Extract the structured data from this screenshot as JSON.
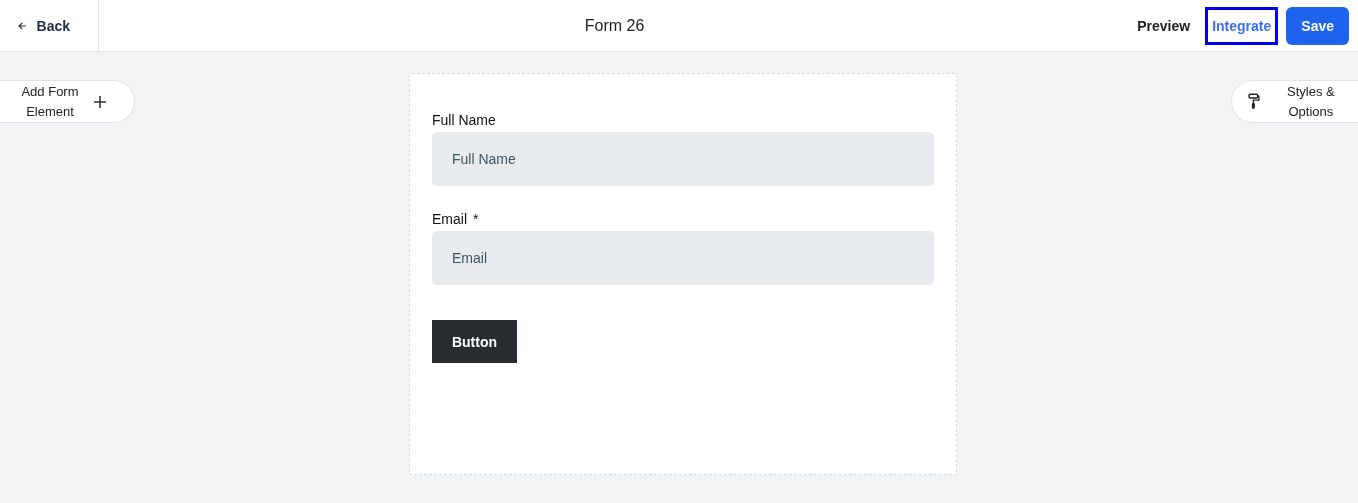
{
  "header": {
    "back": "Back",
    "title": "Form 26",
    "actions": [
      {
        "label": "Preview",
        "kind": "link",
        "focused": false
      },
      {
        "label": "Integrate",
        "kind": "link",
        "focused": true
      },
      {
        "label": "Save",
        "kind": "primary",
        "focused": false
      }
    ]
  },
  "left_panel": {
    "label": "Add Form Element"
  },
  "right_panel": {
    "label": "Styles & Options"
  },
  "form": {
    "fields": [
      {
        "label": "Full Name",
        "placeholder": "Full Name"
      },
      {
        "label": "Email",
        "required_mark": "*",
        "placeholder": "Email"
      }
    ],
    "button": "Button"
  }
}
